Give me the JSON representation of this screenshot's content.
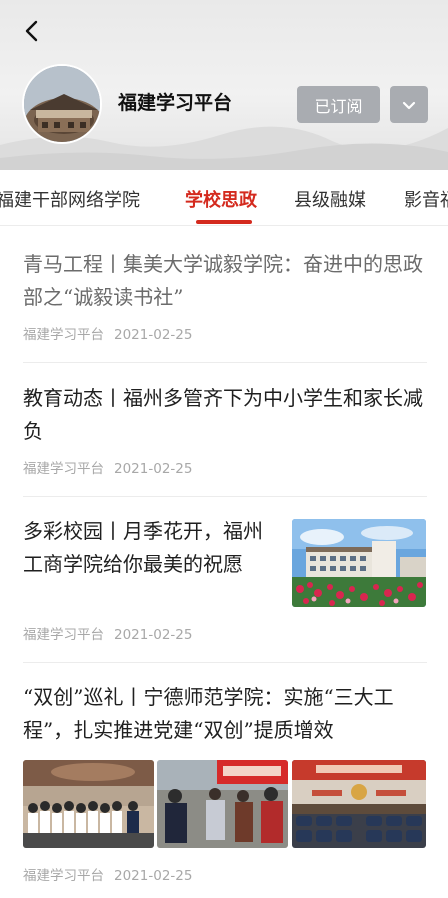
{
  "header": {
    "channel_name": "福建学习平台",
    "subscribe_label": "已订阅",
    "icons": {
      "back": "back-arrow-icon",
      "more": "chevron-down-icon"
    }
  },
  "tabs": [
    {
      "label": "福建干部网络学院",
      "active": false
    },
    {
      "label": "学校思政",
      "active": true
    },
    {
      "label": "县级融媒",
      "active": false
    },
    {
      "label": "影音福",
      "active": false
    }
  ],
  "articles": [
    {
      "title": "青马工程丨集美大学诚毅学院：奋进中的思政部之“诚毅读书社”",
      "source": "福建学习平台",
      "date": "2021-02-25",
      "read": true
    },
    {
      "title": "教育动态丨福州多管齐下为中小学生和家长减负",
      "source": "福建学习平台",
      "date": "2021-02-25",
      "read": false
    },
    {
      "title": "多彩校园丨月季花开，福州工商学院给你最美的祝愿",
      "source": "福建学习平台",
      "date": "2021-02-25",
      "read": false
    },
    {
      "title": "“双创”巡礼丨宁德师范学院：实施“三大工程”，扎实推进党建“双创”提质增效",
      "source": "福建学习平台",
      "date": "2021-02-25",
      "read": false
    }
  ],
  "colors": {
    "accent": "#d42a1e",
    "meta": "#a8a8a8",
    "button": "#a9acb1"
  }
}
